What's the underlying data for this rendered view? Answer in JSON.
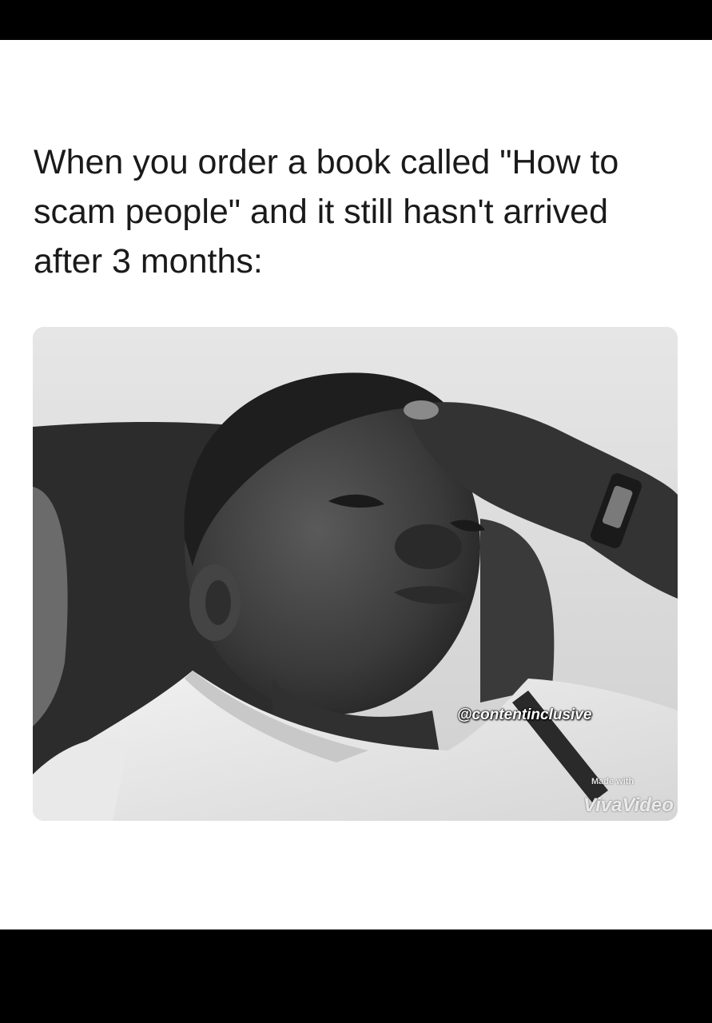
{
  "meme": {
    "caption": "When you order a book called \"How to scam people\" and it still hasn't arrived after 3 months:",
    "watermark": "@contentinclusive",
    "app_watermark": {
      "made_with": "Made with",
      "brand": "VivaVideo"
    }
  },
  "colors": {
    "frame": "#000000",
    "card": "#ffffff",
    "caption_text": "#1a1a1a"
  }
}
